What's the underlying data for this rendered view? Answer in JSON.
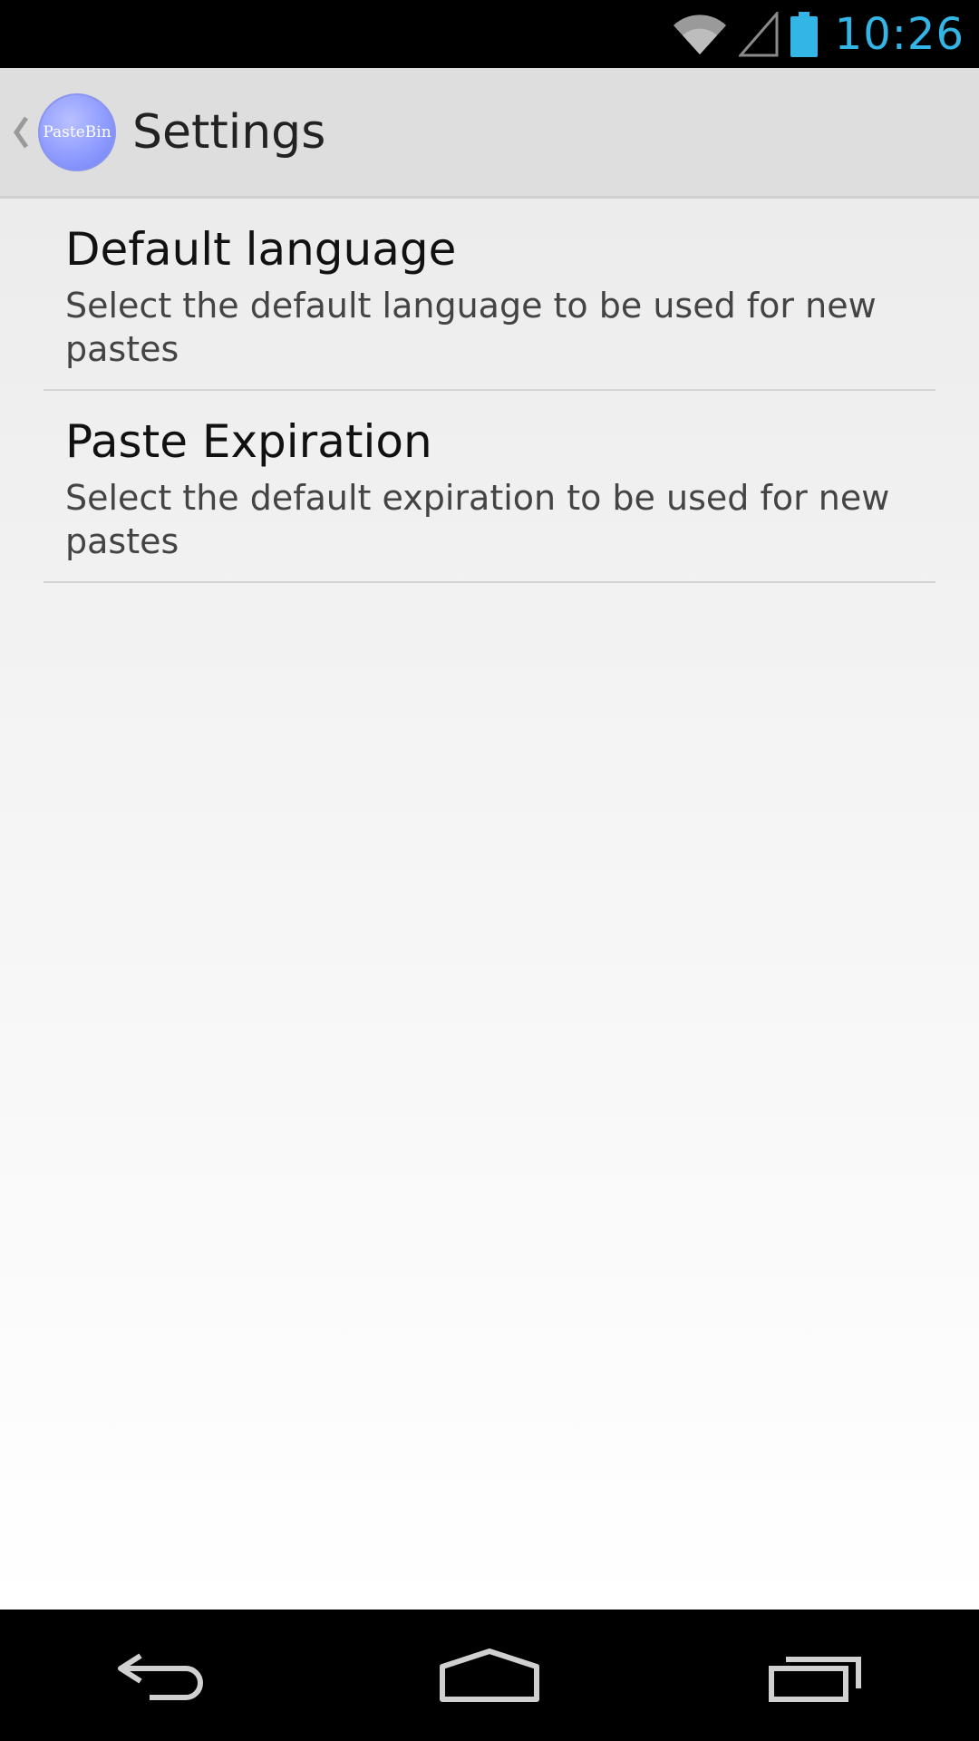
{
  "status_bar": {
    "time": "10:26",
    "icons": [
      "wifi-icon",
      "signal-icon",
      "battery-icon"
    ],
    "accent_color": "#33b5e5"
  },
  "action_bar": {
    "title": "Settings",
    "logo_text": "PasteBin",
    "up_icon": "chevron-left-icon"
  },
  "preferences": [
    {
      "title": "Default language",
      "summary": "Select the default language to be used for new pastes"
    },
    {
      "title": "Paste Expiration",
      "summary": "Select the default expiration to be used for new pastes"
    }
  ],
  "nav_bar": {
    "icons": [
      "back-icon",
      "home-icon",
      "recents-icon"
    ]
  }
}
